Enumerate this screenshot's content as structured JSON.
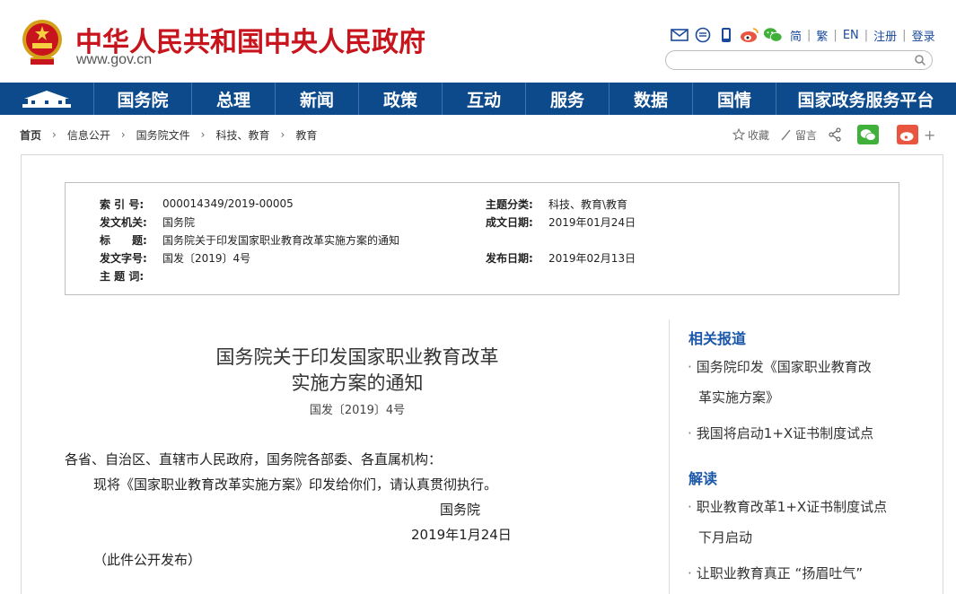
{
  "header": {
    "site_title": "中华人民共和国中央人民政府",
    "site_domain": "www.gov.cn",
    "tool_icons": [
      "mail-icon",
      "message-icon",
      "mobile-icon",
      "weibo-icon",
      "wechat-icon"
    ],
    "lang_links": [
      "简",
      "繁",
      "EN",
      "注册",
      "登录"
    ],
    "search_placeholder": ""
  },
  "nav": {
    "items": [
      "国务院",
      "总理",
      "新闻",
      "政策",
      "互动",
      "服务",
      "数据",
      "国情",
      "国家政务服务平台"
    ]
  },
  "breadcrumb": [
    "首页",
    "信息公开",
    "国务院文件",
    "科技、教育",
    "教育"
  ],
  "share_bar": {
    "favorite_label": "收藏",
    "comment_label": "留言"
  },
  "info_box": {
    "index_label": "索 引 号:",
    "index_value": "000014349/2019-00005",
    "category_label": "主题分类:",
    "category_value": "科技、教育\\教育",
    "issuer_label": "发文机关:",
    "issuer_value": "国务院",
    "created_label": "成文日期:",
    "created_value": "2019年01月24日",
    "title_label": "标　　题:",
    "title_value": "国务院关于印发国家职业教育改革实施方案的通知",
    "docno_label": "发文字号:",
    "docno_value": "国发〔2019〕4号",
    "published_label": "发布日期:",
    "published_value": "2019年02月13日",
    "keywords_label": "主 题 词:"
  },
  "article": {
    "title_line1": "国务院关于印发国家职业教育改革",
    "title_line2": "实施方案的通知",
    "doc_number": "国发〔2019〕4号",
    "addressee": "各省、自治区、直辖市人民政府，国务院各部委、各直属机构：",
    "body": "现将《国家职业教育改革实施方案》印发给你们，请认真贯彻执行。",
    "signature": "国务院",
    "date": "2019年1月24日",
    "note": "（此件公开发布）"
  },
  "sidebar": {
    "related_heading": "相关报道",
    "related_items": [
      [
        "国务院印发《国家职业教育改",
        "革实施方案》"
      ],
      [
        "我国将启动1+X证书制度试点"
      ]
    ],
    "interpret_heading": "解读",
    "interpret_items": [
      [
        "职业教育改革1+X证书制度试点",
        "下月启动"
      ],
      [
        "让职业教育真正 “扬眉吐气”"
      ]
    ]
  },
  "colors": {
    "brand_red": "#c8141c",
    "nav_blue": "#0c4a8c",
    "link_blue": "#1a57a8",
    "wechat_green": "#3fb03a",
    "weibo_red": "#e9563f"
  }
}
